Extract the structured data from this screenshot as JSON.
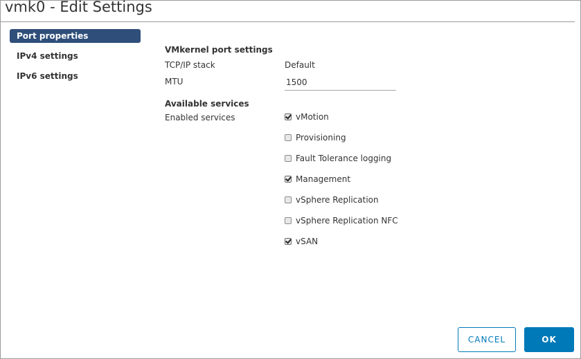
{
  "dialog": {
    "title": "vmk0 - Edit Settings"
  },
  "nav": {
    "items": [
      {
        "label": "Port properties",
        "active": true
      },
      {
        "label": "IPv4 settings",
        "active": false
      },
      {
        "label": "IPv6 settings",
        "active": false
      }
    ]
  },
  "port_settings": {
    "section_title": "VMkernel port settings",
    "tcpip_label": "TCP/IP stack",
    "tcpip_value": "Default",
    "mtu_label": "MTU",
    "mtu_value": "1500"
  },
  "services": {
    "section_title": "Available services",
    "enabled_label": "Enabled services",
    "items": [
      {
        "label": "vMotion",
        "checked": true
      },
      {
        "label": "Provisioning",
        "checked": false
      },
      {
        "label": "Fault Tolerance logging",
        "checked": false
      },
      {
        "label": "Management",
        "checked": true
      },
      {
        "label": "vSphere Replication",
        "checked": false
      },
      {
        "label": "vSphere Replication NFC",
        "checked": false
      },
      {
        "label": "vSAN",
        "checked": true
      }
    ]
  },
  "footer": {
    "cancel_label": "CANCEL",
    "ok_label": "OK"
  },
  "colors": {
    "accent": "#0079b8",
    "nav_active": "#2f4f7a"
  }
}
